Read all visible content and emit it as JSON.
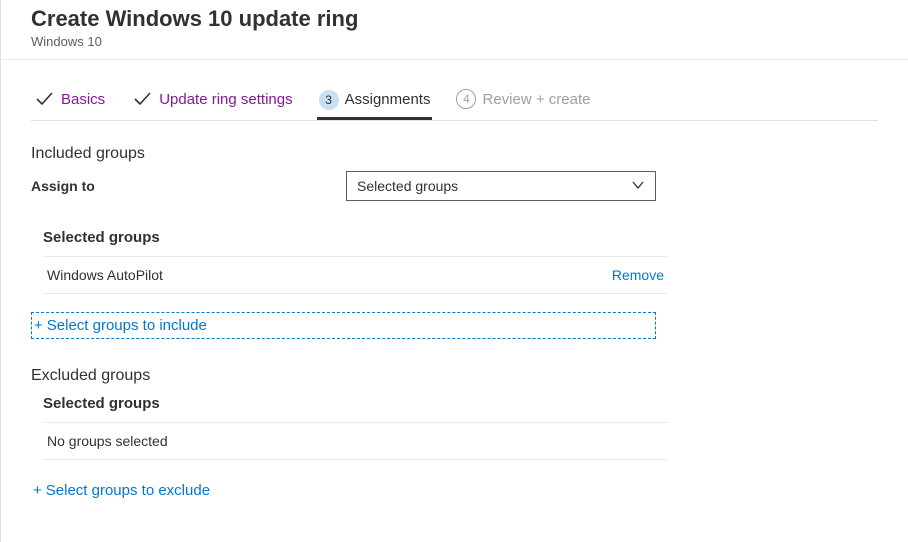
{
  "header": {
    "title": "Create Windows 10 update ring",
    "subtitle": "Windows 10"
  },
  "tabs": {
    "basics": "Basics",
    "settings": "Update ring settings",
    "assignments_num": "3",
    "assignments": "Assignments",
    "review_num": "4",
    "review": "Review + create"
  },
  "included": {
    "heading": "Included groups",
    "assign_to_label": "Assign to",
    "assign_to_value": "Selected groups",
    "selected_heading": "Selected groups",
    "group_name": "Windows AutoPilot",
    "remove": "Remove",
    "add_link": "Select groups to include"
  },
  "excluded": {
    "heading": "Excluded groups",
    "selected_heading": "Selected groups",
    "empty": "No groups selected",
    "add_link": "Select groups to exclude"
  }
}
